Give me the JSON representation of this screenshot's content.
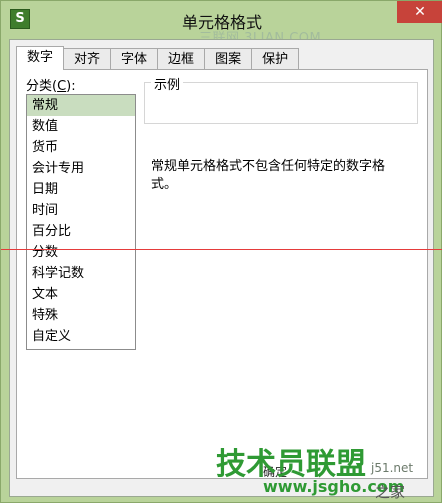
{
  "window": {
    "title": "单元格格式",
    "icon_label": "S",
    "close_label": "✕"
  },
  "watermarks": {
    "top": "三联网 3LIAN.COM",
    "big": "技术员联盟",
    "url": "www.jsgho.com",
    "side": "j51.net",
    "corner": "之家"
  },
  "tabs": [
    {
      "label": "数字",
      "active": true
    },
    {
      "label": "对齐"
    },
    {
      "label": "字体"
    },
    {
      "label": "边框"
    },
    {
      "label": "图案"
    },
    {
      "label": "保护"
    }
  ],
  "category": {
    "label_prefix": "分类(",
    "label_key": "C",
    "label_suffix": "):",
    "items": [
      "常规",
      "数值",
      "货币",
      "会计专用",
      "日期",
      "时间",
      "百分比",
      "分数",
      "科学记数",
      "文本",
      "特殊",
      "自定义"
    ],
    "selected": "常规"
  },
  "sample": {
    "legend": "示例"
  },
  "description": "常规单元格格式不包含任何特定的数字格式。",
  "ok_button": "确定",
  "colors": {
    "frame": "#b9d39a",
    "selected_item": "#c9ddbf",
    "close_button": "#c7433a",
    "watermark_green": "#2f9a34",
    "red_line": "#e53b3b"
  }
}
